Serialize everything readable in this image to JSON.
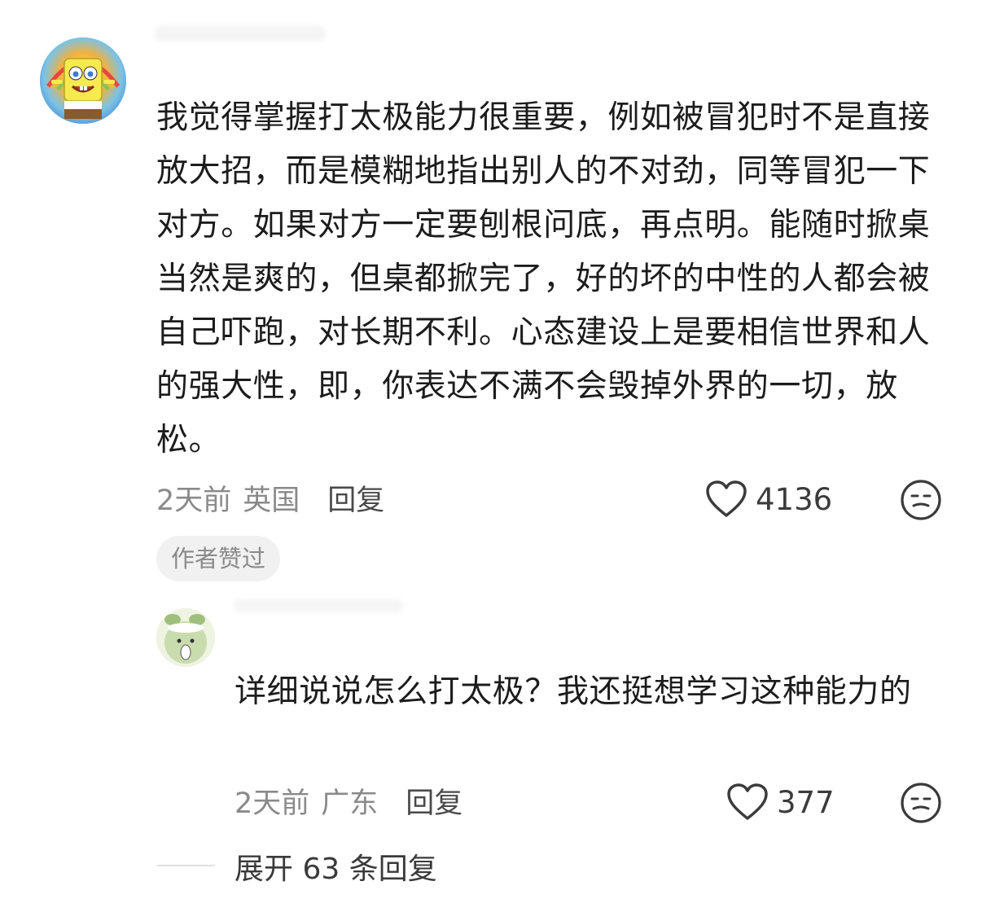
{
  "main_comment": {
    "text": "我觉得掌握打太极能力很重要，例如被冒犯时不是直接放大招，而是模糊地指出别人的不对劲，同等冒犯一下对方。如果对方一定要刨根问底，再点明。能随时掀桌当然是爽的，但桌都掀完了，好的坏的中性的人都会被自己吓跑，对长期不利。心态建设上是要相信世界和人的强大性，即，你表达不满不会毁掉外界的一切，放松。",
    "time": "2天前",
    "location": "英国",
    "reply_label": "回复",
    "like_count": "4136",
    "author_badge": "作者赞过",
    "avatar_icon": "spongebob-avatar-icon"
  },
  "sub_comment": {
    "text": "详细说说怎么打太极？我还挺想学习这种能力的",
    "time": "2天前",
    "location": "广东",
    "reply_label": "回复",
    "like_count": "377",
    "avatar_icon": "green-cartoon-avatar-icon"
  },
  "expand_replies_label": "展开 63 条回复",
  "icons": {
    "like": "heart-outline-icon",
    "dislike": "expressionless-face-icon"
  },
  "colors": {
    "text": "#1c1c1c",
    "meta": "#8a8a8a",
    "badge_bg": "#f1f1f1"
  }
}
